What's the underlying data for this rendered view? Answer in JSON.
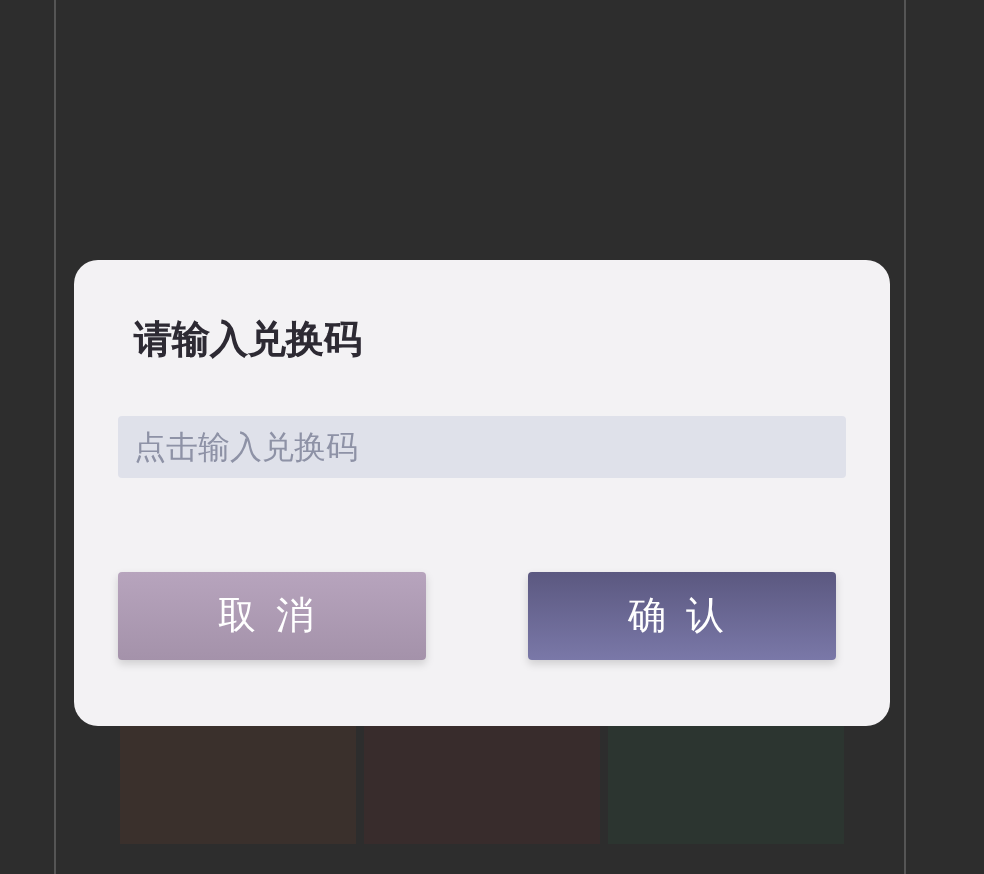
{
  "dialog": {
    "title": "请输入兑换码",
    "code_field": {
      "placeholder": "点击输入兑换码"
    },
    "buttons": [
      {
        "label": "取消",
        "kind": "cancel"
      },
      {
        "label": "确认",
        "kind": "confirm"
      }
    ]
  }
}
